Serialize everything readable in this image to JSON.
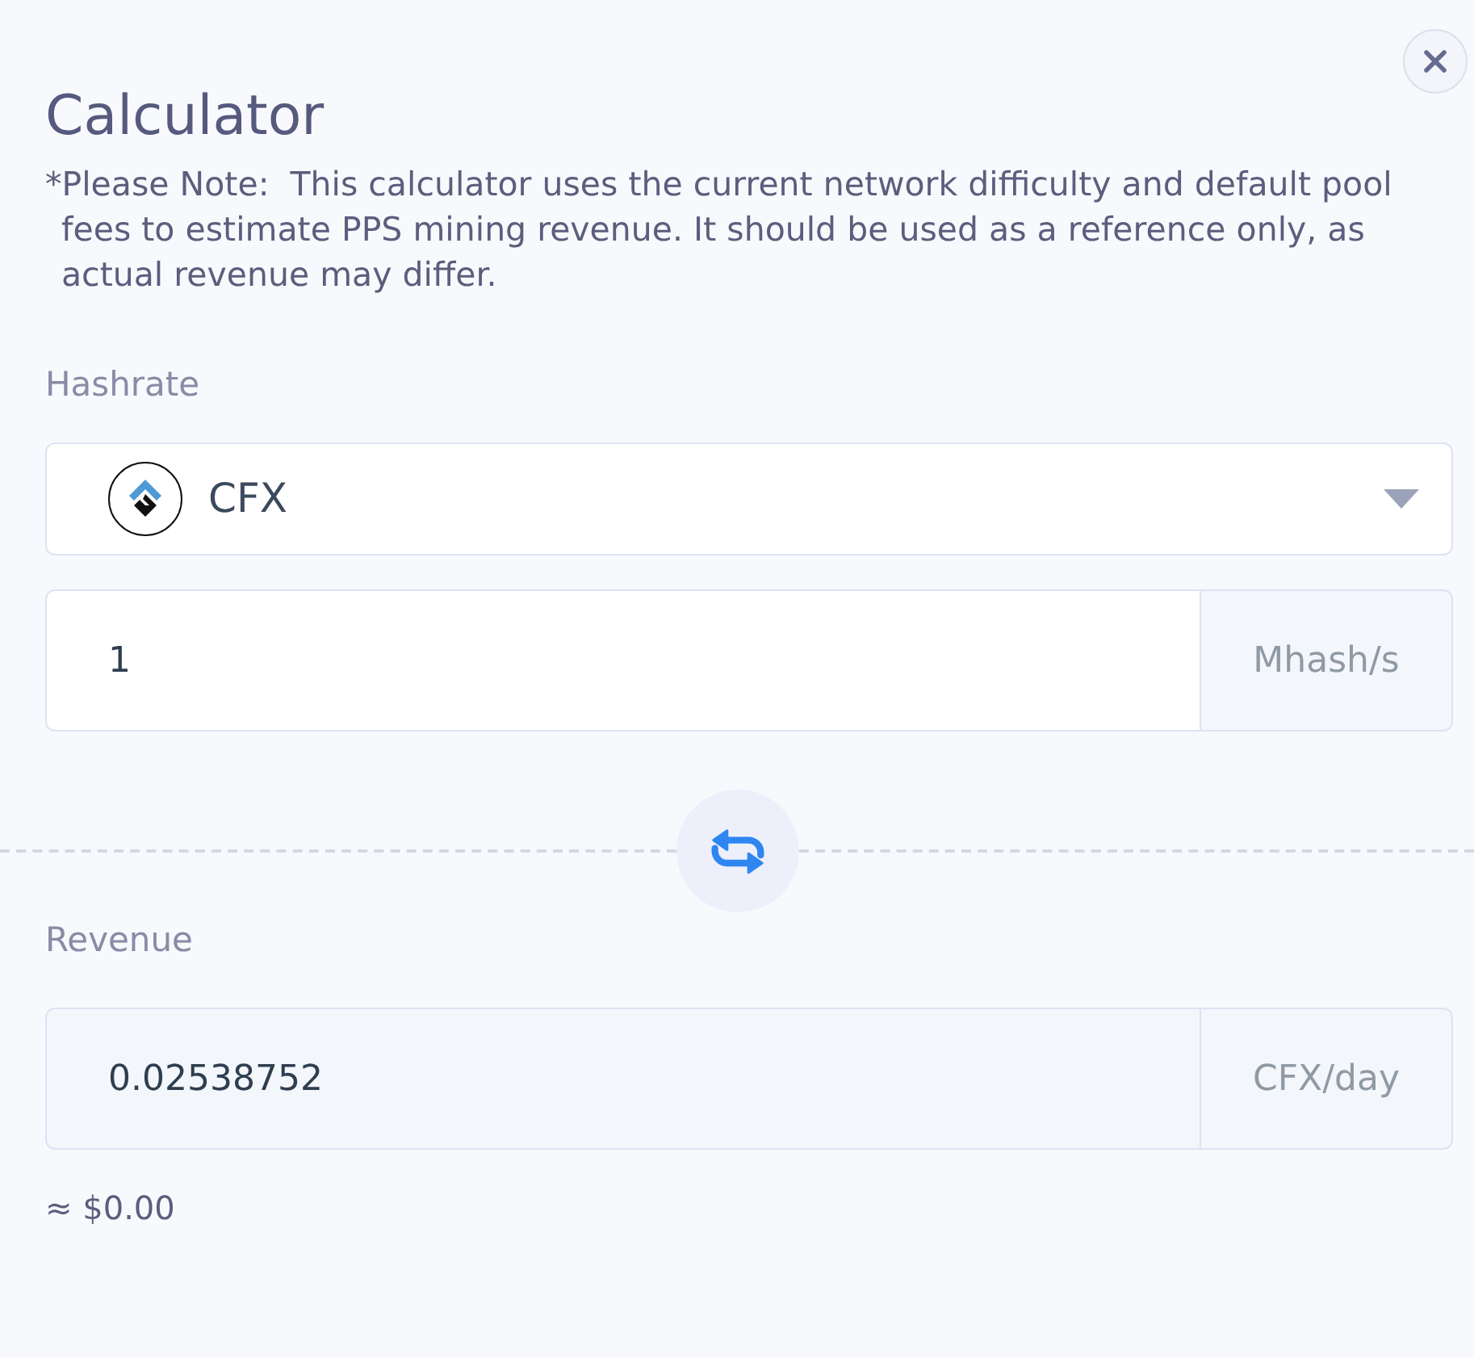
{
  "dialog": {
    "title": "Calculator",
    "note": "*Please Note:  This calculator uses the current network difficulty and default pool fees to estimate PPS mining revenue. It should be used as a reference only, as actual revenue may differ."
  },
  "hashrate": {
    "label": "Hashrate",
    "coin": "CFX",
    "value": "1",
    "unit": "Mhash/s"
  },
  "revenue": {
    "label": "Revenue",
    "value": "0.02538752",
    "unit": "CFX/day",
    "fiat": "≈ $0.00"
  }
}
